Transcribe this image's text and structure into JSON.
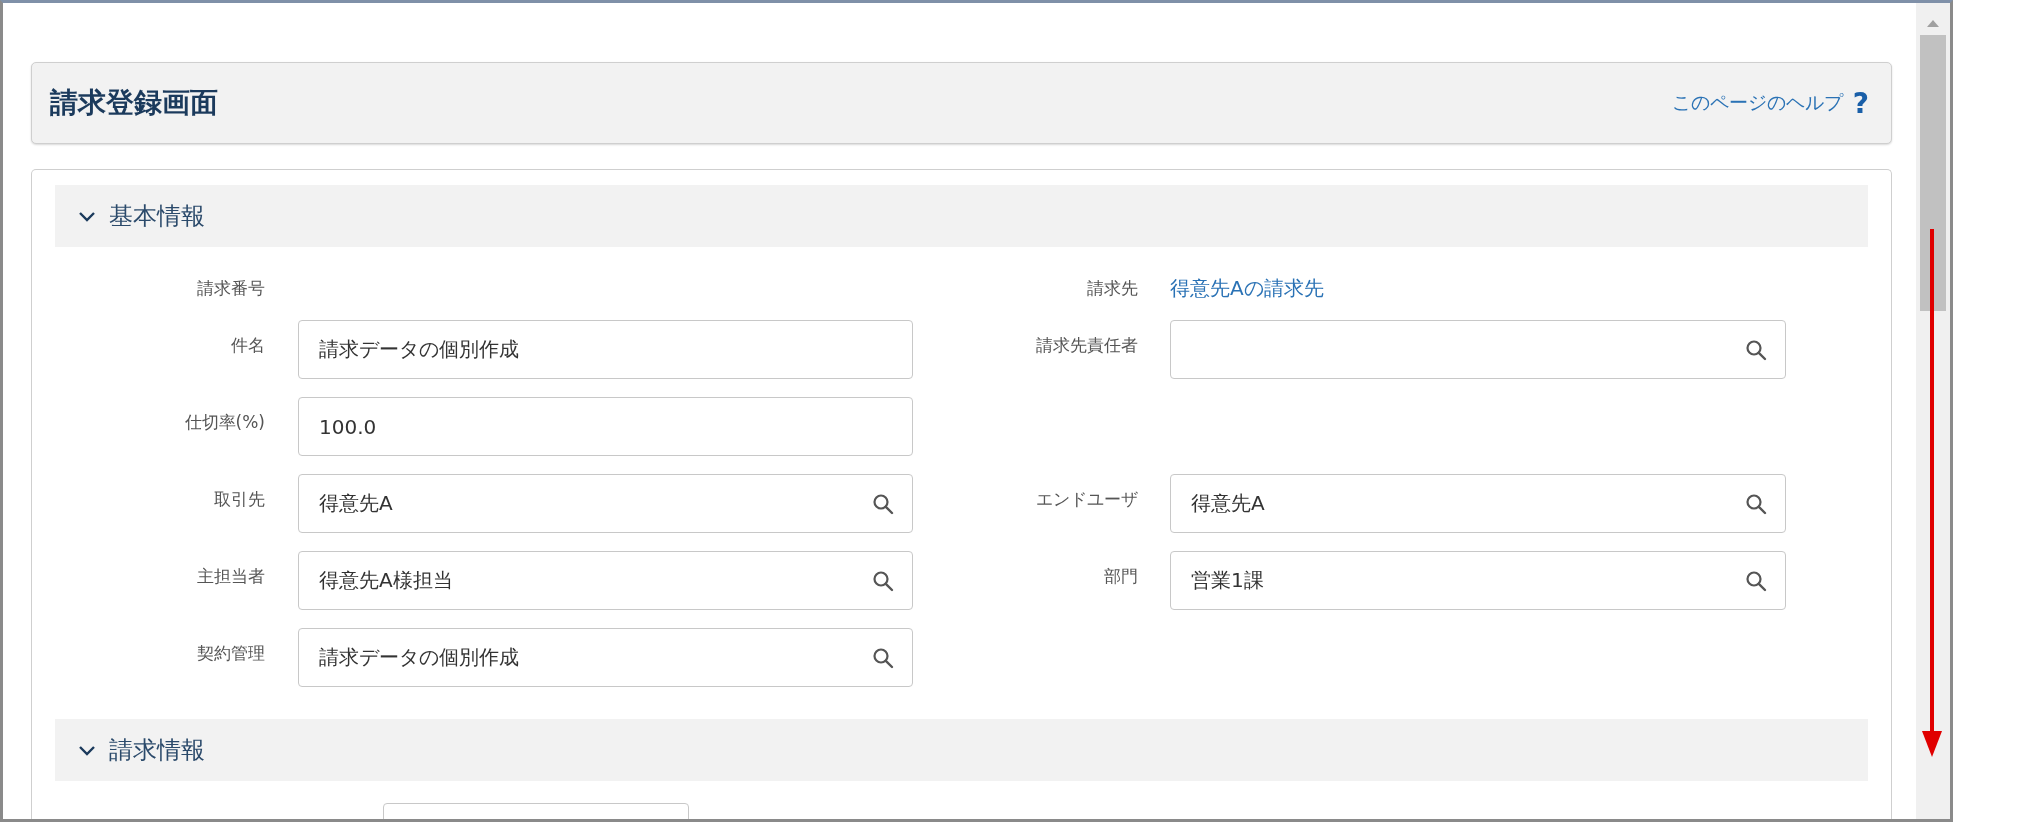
{
  "page": {
    "title": "請求登録画面",
    "help_link": "このページのヘルプ",
    "help_mark": "?"
  },
  "sections": [
    {
      "title": "基本情報",
      "expanded": true,
      "rows": [
        {
          "left": {
            "label": "請求番号",
            "kind": "text"
          },
          "right": {
            "label": "請求先",
            "kind": "link",
            "value": "得意先Aの請求先"
          }
        },
        {
          "left": {
            "label": "件名",
            "kind": "input",
            "value": "請求データの個別作成"
          },
          "right": {
            "label": "請求先責任者",
            "kind": "lookup"
          }
        },
        {
          "left": {
            "label": "仕切率(%)",
            "kind": "input",
            "value": "100.0"
          }
        },
        {
          "left": {
            "label": "取引先",
            "kind": "lookup",
            "value": "得意先A"
          },
          "right": {
            "label": "エンドユーザ",
            "kind": "lookup",
            "value": "得意先A"
          }
        },
        {
          "left": {
            "label": "主担当者",
            "kind": "lookup",
            "value": "得意先A様担当"
          },
          "right": {
            "label": "部門",
            "kind": "lookup",
            "value": "営業1課"
          }
        },
        {
          "left": {
            "label": "契約管理",
            "kind": "lookup",
            "value": "請求データの個別作成"
          }
        }
      ]
    },
    {
      "title": "請求情報",
      "expanded": true
    }
  ]
}
